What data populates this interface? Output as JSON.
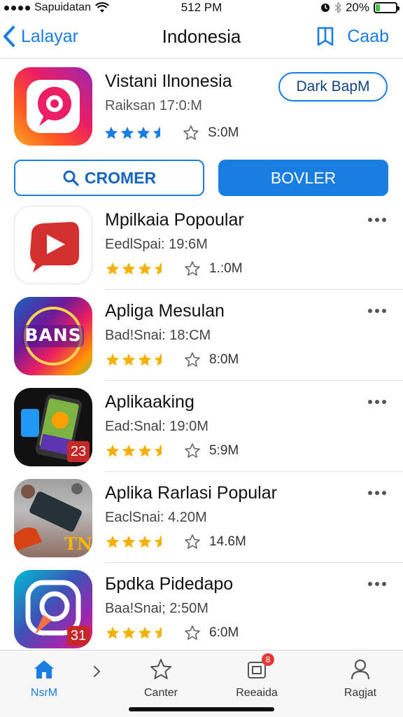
{
  "status_bar": {
    "carrier": "Sapuidatan",
    "time": "512 PM",
    "battery": "20%",
    "battery_level": 0.2
  },
  "nav": {
    "back_label": "Lalayar",
    "title": "Indonesia",
    "right_label": "Caab"
  },
  "featured": {
    "name": "Vistani Ilnonesia",
    "subtitle": "Raiksan 17:0:M",
    "stars": 3.5,
    "count": "S:0M",
    "dark_button": "Dark BapM"
  },
  "actions": {
    "outline_label": "CROMER",
    "fill_label": "BOVLER"
  },
  "apps": [
    {
      "name": "Mpilkaia Popoular",
      "subtitle": "EedlSpai: 19:6M",
      "stars": 3.5,
      "count": "1.:0M"
    },
    {
      "name": "Apliga Mesulan",
      "subtitle": "Bad!Snai: 18:CM",
      "stars": 3.5,
      "count": "8:0M",
      "icon_text": "BANS"
    },
    {
      "name": "Aplikaaking",
      "subtitle": "Ead:Snal: 19:0M",
      "stars": 3.5,
      "count": "5:9M",
      "icon_badge": "23"
    },
    {
      "name": "Aplika Rarlasi Popular",
      "subtitle": "EaclSnai: 4.20M",
      "stars": 3.5,
      "count": "14.6M",
      "icon_text": "TN"
    },
    {
      "name": "Бpdka Pidedapo",
      "subtitle": "Baa!Snai; 2:50M",
      "stars": 3.5,
      "count": "6:0M",
      "icon_badge": "31"
    }
  ],
  "tabs": [
    {
      "label": "NsrM",
      "icon": "house-icon",
      "active": true
    },
    {
      "label": "Canter",
      "icon": "star-icon",
      "active": false
    },
    {
      "label": "Reeaida",
      "icon": "inbox-icon",
      "active": false,
      "badge": "8"
    },
    {
      "label": "Ragjat",
      "icon": "person-icon",
      "active": false
    }
  ],
  "colors": {
    "accent": "#1a7de2",
    "star_filled": "#f5b000",
    "star_featured": "#1a7de2"
  }
}
